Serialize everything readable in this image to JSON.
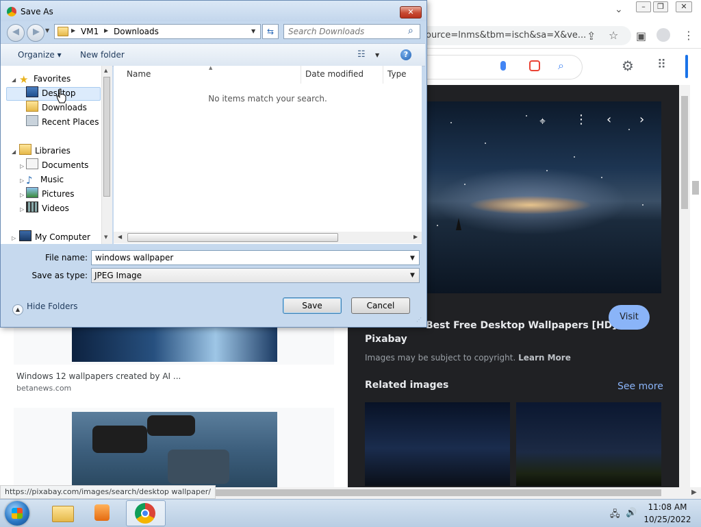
{
  "dialog": {
    "title": "Save As",
    "breadcrumb": [
      "VM1",
      "Downloads"
    ],
    "search_placeholder": "Search Downloads",
    "toolbar": {
      "organize": "Organize ▾",
      "new_folder": "New folder"
    },
    "nav": {
      "favorites": "Favorites",
      "desktop": "Desktop",
      "downloads": "Downloads",
      "recent_places": "Recent Places",
      "libraries": "Libraries",
      "documents": "Documents",
      "music": "Music",
      "pictures": "Pictures",
      "videos": "Videos",
      "my_computer": "My Computer"
    },
    "columns": {
      "name": "Name",
      "date_modified": "Date modified",
      "type": "Type"
    },
    "empty_message": "No items match your search.",
    "file_name_label": "File name:",
    "file_name_value": "windows wallpaper",
    "save_type_label": "Save as type:",
    "save_type_value": "JPEG Image",
    "hide_folders": "Hide Folders",
    "save_button": "Save",
    "cancel_button": "Cancel"
  },
  "browser": {
    "url_fragment": "ource=lnms&tbm=isch&sa=X&ve...",
    "status_url": "https://pixabay.com/images/search/desktop wallpaper/",
    "preview": {
      "title": "Best Free Desktop Wallpapers [HD] -",
      "source": "Pixabay",
      "copyright_text": "Images may be subject to copyright.",
      "learn_more": "Learn More",
      "visit": "Visit",
      "related_images": "Related images",
      "see_more": "See more"
    },
    "results": [
      {
        "title": "Windows 12 wallpapers created by AI ...",
        "source": "betanews.com"
      }
    ]
  },
  "taskbar": {
    "time": "11:08 AM",
    "date": "10/25/2022"
  },
  "colors": {
    "accent_blue": "#8ab4f8",
    "dark_panel": "#202124",
    "dialog_frame": "#c6d9ee"
  }
}
